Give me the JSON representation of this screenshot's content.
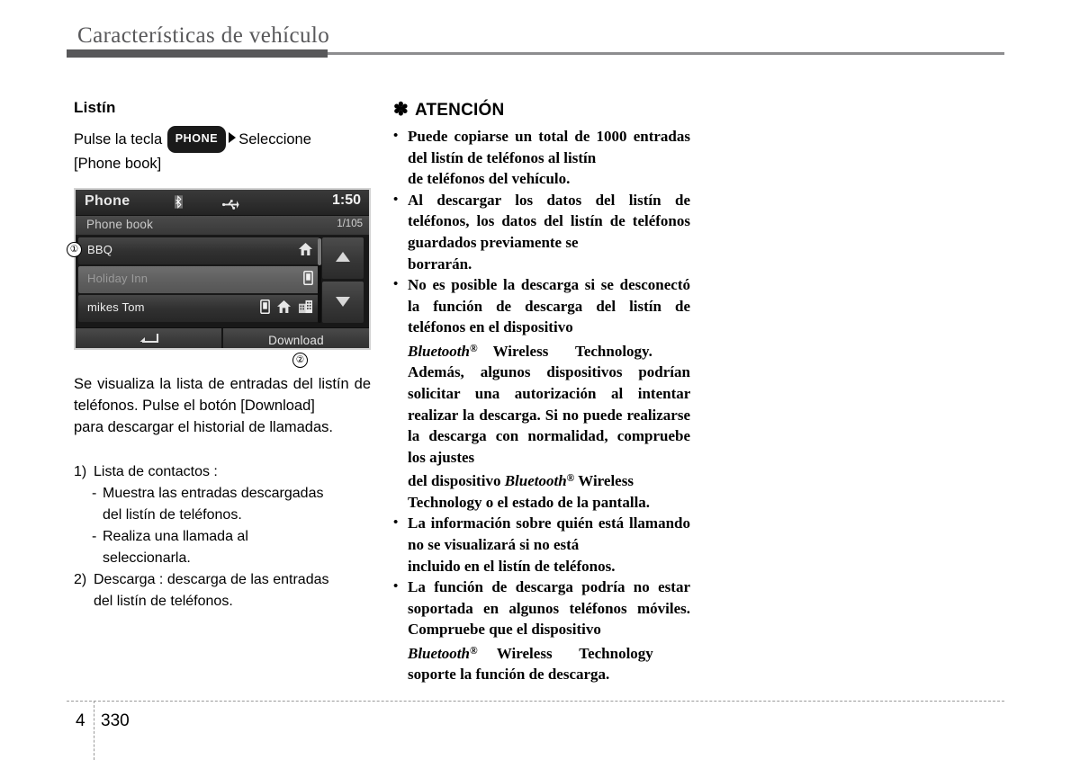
{
  "header": {
    "title": "Características de vehículo"
  },
  "left": {
    "section_title": "Listín",
    "instruction": {
      "before_key": "Pulse la tecla",
      "key_label": "PHONE",
      "arrow_icon": "triangle-right-icon",
      "after_key": "Seleccione",
      "second_line": "[Phone book]"
    },
    "device": {
      "title": "Phone",
      "bluetooth_icon": "bluetooth-icon",
      "usb_icon": "usb-icon",
      "time": "1:50",
      "subtitle": "Phone book",
      "page_indicator": "1/105",
      "rows": [
        {
          "label": "BBQ",
          "selected": false,
          "icons": [
            "home-icon"
          ]
        },
        {
          "label": "Holiday Inn",
          "selected": true,
          "icons": [
            "mobile-icon"
          ]
        },
        {
          "label": "mikes Tom",
          "selected": false,
          "icons": [
            "mobile-icon",
            "home-icon",
            "office-icon"
          ]
        }
      ],
      "scroll_up_icon": "triangle-up-icon",
      "scroll_down_icon": "triangle-down-icon",
      "back_button_icon": "back-arrow-icon",
      "download_button_label": "Download"
    },
    "callouts": {
      "one": "①",
      "two": "②"
    },
    "caption": {
      "line1": "Se visualiza la lista de entradas del listín",
      "line2": "de teléfonos. Pulse el botón [Download]",
      "line3": "para descargar el historial de llamadas."
    },
    "numbered_list": [
      {
        "marker": "1)",
        "text": "Lista de contactos :",
        "sub_items": [
          {
            "marker": "-",
            "line1": "Muestra las entradas descargadas",
            "line2": "del listín de teléfonos."
          },
          {
            "marker": "-",
            "line1": "Realiza una llamada al",
            "line2": "seleccionarla."
          }
        ]
      },
      {
        "marker": "2)",
        "line1": "Descarga : descarga de las entradas",
        "line2": "del listín de teléfonos.",
        "sub_items": []
      }
    ]
  },
  "right": {
    "attention_icon": "✽",
    "attention_title": "ATENCIÓN",
    "bullets": [
      {
        "bullet": "•",
        "lines": [
          "Puede copiarse un total de 1000",
          "entradas del listín de teléfonos al listín",
          "de teléfonos del vehículo."
        ]
      },
      {
        "bullet": "•",
        "lines": [
          "Al descargar los datos del listín de",
          "teléfonos, los datos del listín de",
          "teléfonos guardados previamente se",
          "borrarán."
        ]
      },
      {
        "bullet": "•",
        "lines": [
          "No es posible la descarga si se",
          "desconectó la función de descarga del",
          "listín de teléfonos en el dispositivo",
          "Bluetooth® Wireless Technology.",
          "Además, algunos dispositivos podrían",
          "solicitar una autorización al intentar",
          "realizar la descarga. Si no puede",
          "realizarse la descarga con",
          "normalidad, compruebe los ajustes",
          "del dispositivo Bluetooth® Wireless",
          "Technology o el estado de la pantalla."
        ]
      },
      {
        "bullet": "•",
        "lines": [
          "La información sobre quién está",
          "llamando no se visualizará si no está",
          "incluido en el listín de teléfonos."
        ]
      },
      {
        "bullet": "•",
        "lines": [
          "La función de descarga podría no",
          "estar soportada en algunos teléfonos",
          "móviles. Compruebe que el dispositivo",
          "Bluetooth® Wireless Technology",
          "soporte la función de descarga."
        ]
      }
    ],
    "trademark": {
      "name": "Bluetooth",
      "symbol": "®"
    }
  },
  "footer": {
    "chapter": "4",
    "page_number": "330"
  }
}
